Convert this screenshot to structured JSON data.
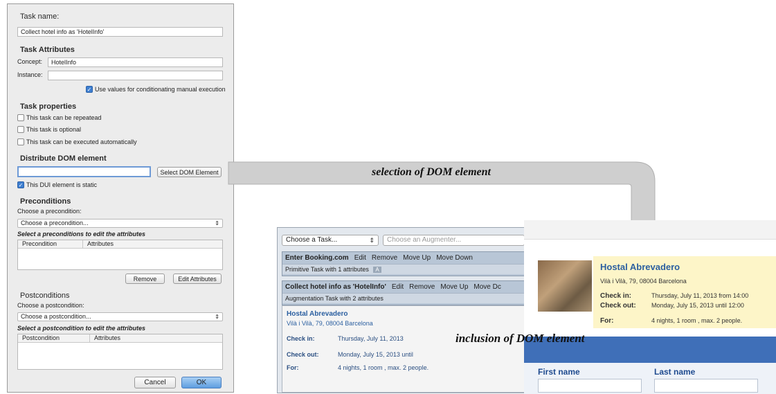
{
  "dialog": {
    "task_name_label": "Task name:",
    "task_name_value": "Collect hotel info as 'HotelInfo'",
    "attributes_title": "Task Attributes",
    "concept_label": "Concept:",
    "concept_value": "HotelInfo",
    "instance_label": "Instance:",
    "instance_value": "",
    "use_values_label": "Use values for conditionating manual execution",
    "properties_title": "Task properties",
    "repeated_label": "This task can be repeatead",
    "optional_label": "This task is optional",
    "auto_label": "This task can be executed automatically",
    "distribute_title": "Distribute DOM element",
    "distribute_value": "",
    "select_dom_button": "Select DOM Element",
    "static_label": "This DUI element is static",
    "preconditions_title": "Preconditions",
    "choose_precondition_label": "Choose a precondition:",
    "precondition_select": "Choose a precondition...",
    "select_precondition_hint": "Select a preconditions to edit the attributes",
    "precondition_col": "Precondition",
    "attributes_col": "Attributes",
    "remove_button": "Remove",
    "edit_attributes_button": "Edit Attributes",
    "postconditions_title": "Postconditions",
    "choose_postcondition_label": "Choose a postcondition:",
    "postcondition_select": "Choose a postcondition...",
    "select_postcondition_hint": "Select a postcondition to edit the attributes",
    "postcondition_col": "Postcondition",
    "attributes_col2": "Attributes",
    "cancel_button": "Cancel",
    "ok_button": "OK"
  },
  "arrows": {
    "selection_label": "selection of DOM element",
    "inclusion_label": "inclusion of DOM element"
  },
  "left_panel": {
    "task_select": "Choose a Task...",
    "augmenter_select": "Choose an Augmenter...",
    "task1": {
      "name": "Enter Booking.com",
      "actions": [
        "Edit",
        "Remove",
        "Move Up",
        "Move Down"
      ],
      "subtitle": "Primitive Task with 1 attributes",
      "badge": "A"
    },
    "task2": {
      "name": "Collect hotel info as 'HotelInfo'",
      "actions": [
        "Edit",
        "Remove",
        "Move Up",
        "Move Dc"
      ],
      "subtitle": "Augmentation Task with 2 attributes"
    },
    "hotel": {
      "name": "Hostal Abrevadero",
      "address": "Vilà i Vilà, 79, 08004 Barcelona",
      "checkin_label": "Check in:",
      "checkin_value": "Thursday, July 11, 2013",
      "checkout_label": "Check out:",
      "checkout_value": "Monday, July 15, 2013 until",
      "for_label": "For:",
      "for_value": "4 nights, 1 room , max. 2 people."
    }
  },
  "right_panel": {
    "hotel_name": "Hostal Abrevadero",
    "address": "Vilà i Vilà, 79, 08004 Barcelona",
    "checkin_label": "Check in:",
    "checkin_value": "Thursday, July 11, 2013 from 14:00",
    "checkout_label": "Check out:",
    "checkout_value": "Monday, July 15, 2013 until 12:00",
    "for_label": "For:",
    "for_value": "4 nights, 1 room , max. 2 people.",
    "first_name_label": "First name",
    "last_name_label": "Last name"
  }
}
